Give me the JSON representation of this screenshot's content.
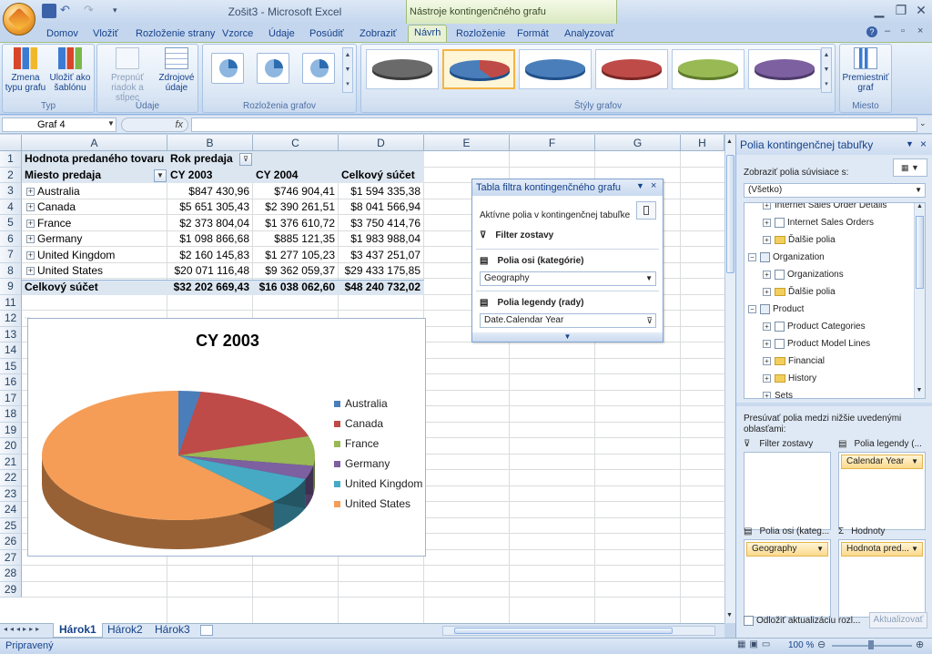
{
  "window": {
    "title": "Zošit3 - Microsoft Excel",
    "context_tab_group": "Nástroje kontingenčného grafu"
  },
  "tabs": [
    "Domov",
    "Vložiť",
    "Rozloženie strany",
    "Vzorce",
    "Údaje",
    "Posúdiť",
    "Zobraziť",
    "Návrh",
    "Rozloženie",
    "Formát",
    "Analyzovať"
  ],
  "active_tab": "Návrh",
  "ribbon": {
    "typ": {
      "label": "Typ",
      "change_type": "Zmena typu grafu",
      "save_template": "Uložiť ako šablónu"
    },
    "udaje": {
      "label": "Údaje",
      "switch_row_col": "Prepnúť riadok a stĺpec",
      "select_data": "Zdrojové údaje"
    },
    "layouts": {
      "label": "Rozloženia grafov"
    },
    "styles": {
      "label": "Štýly grafov"
    },
    "miesto": {
      "label": "Miesto",
      "move_chart": "Premiestniť graf"
    }
  },
  "formula_bar": {
    "name_box": "Graf 4",
    "fx": "fx"
  },
  "columns": [
    "A",
    "B",
    "C",
    "D",
    "E",
    "F",
    "G",
    "H"
  ],
  "rows": [
    "1",
    "2",
    "3",
    "4",
    "5",
    "6",
    "7",
    "8",
    "9",
    "11",
    "12",
    "13",
    "14",
    "15",
    "16",
    "17",
    "18",
    "19",
    "20",
    "21",
    "22",
    "23",
    "24",
    "25",
    "26",
    "27",
    "28",
    "29"
  ],
  "pivot": {
    "r1": {
      "a": "Hodnota predaného tovaru",
      "b": "Rok predaja"
    },
    "r2": {
      "a": "Miesto predaja",
      "b": "CY 2003",
      "c": "CY 2004",
      "d": "Celkový súčet"
    },
    "data": [
      {
        "name": "Australia",
        "cy2003": "$847 430,96",
        "cy2004": "$746 904,41",
        "total": "$1 594 335,38"
      },
      {
        "name": "Canada",
        "cy2003": "$5 651 305,43",
        "cy2004": "$2 390 261,51",
        "total": "$8 041 566,94"
      },
      {
        "name": "France",
        "cy2003": "$2 373 804,04",
        "cy2004": "$1 376 610,72",
        "total": "$3 750 414,76"
      },
      {
        "name": "Germany",
        "cy2003": "$1 098 866,68",
        "cy2004": "$885 121,35",
        "total": "$1 983 988,04"
      },
      {
        "name": "United Kingdom",
        "cy2003": "$2 160 145,83",
        "cy2004": "$1 277 105,23",
        "total": "$3 437 251,07"
      },
      {
        "name": "United States",
        "cy2003": "$20 071 116,48",
        "cy2004": "$9 362 059,37",
        "total": "$29 433 175,85"
      }
    ],
    "total": {
      "a": "Celkový súčet",
      "b": "$32 202 669,43",
      "c": "$16 038 062,60",
      "d": "$48 240 732,02"
    }
  },
  "chart_data": {
    "type": "pie",
    "title": "CY 2003",
    "categories": [
      "Australia",
      "Canada",
      "France",
      "Germany",
      "United Kingdom",
      "United States"
    ],
    "values": [
      847430.96,
      5651305.43,
      2373804.04,
      1098866.68,
      2160145.83,
      20071116.48
    ],
    "colors": [
      "#4a7ebb",
      "#be4b48",
      "#98b954",
      "#7d60a0",
      "#46aac5",
      "#f59d56"
    ],
    "legend_position": "right"
  },
  "filter_pane": {
    "title": "Tabla filtra kontingenčného grafu",
    "active": "Aktívne polia v kontingenčnej tabuľke",
    "report_filter": "Filter zostavy",
    "axis_label": "Polia osi (kategórie)",
    "axis_value": "Geography",
    "legend_label": "Polia legendy (rady)",
    "legend_value": "Date.Calendar Year"
  },
  "sheets": [
    "Hárok1",
    "Hárok2",
    "Hárok3"
  ],
  "active_sheet": "Hárok1",
  "status": {
    "ready": "Pripravený",
    "zoom": "100 %"
  },
  "field_list": {
    "title": "Polia kontingenčnej tabuľky",
    "show_label": "Zobraziť polia súvisiace s:",
    "show_value": "(Všetko)",
    "tree": [
      {
        "t": "Internet Sales Order Details",
        "kind": "cut"
      },
      {
        "t": "Internet Sales Orders",
        "kind": "cb"
      },
      {
        "t": "Ďalšie polia",
        "kind": "fold"
      },
      {
        "t": "Organization",
        "kind": "grp"
      },
      {
        "t": "Organizations",
        "kind": "cb"
      },
      {
        "t": "Ďalšie polia",
        "kind": "fold"
      },
      {
        "t": "Product",
        "kind": "grp"
      },
      {
        "t": "Product Categories",
        "kind": "cb"
      },
      {
        "t": "Product Model Lines",
        "kind": "cb"
      },
      {
        "t": "Financial",
        "kind": "folder"
      },
      {
        "t": "History",
        "kind": "folder"
      },
      {
        "t": "Sets",
        "kind": "cut"
      }
    ],
    "move_label": "Presúvať polia medzi nižšie uvedenými oblasťami:",
    "areas": {
      "filter": "Filter zostavy",
      "legend": "Polia legendy (...",
      "axis": "Polia osi (kateg...",
      "values": "Hodnoty"
    },
    "chips": {
      "legend": "Calendar Year",
      "axis": "Geography",
      "values": "Hodnota pred..."
    },
    "defer": "Odložiť aktualizáciu rozl...",
    "update": "Aktualizovať"
  }
}
